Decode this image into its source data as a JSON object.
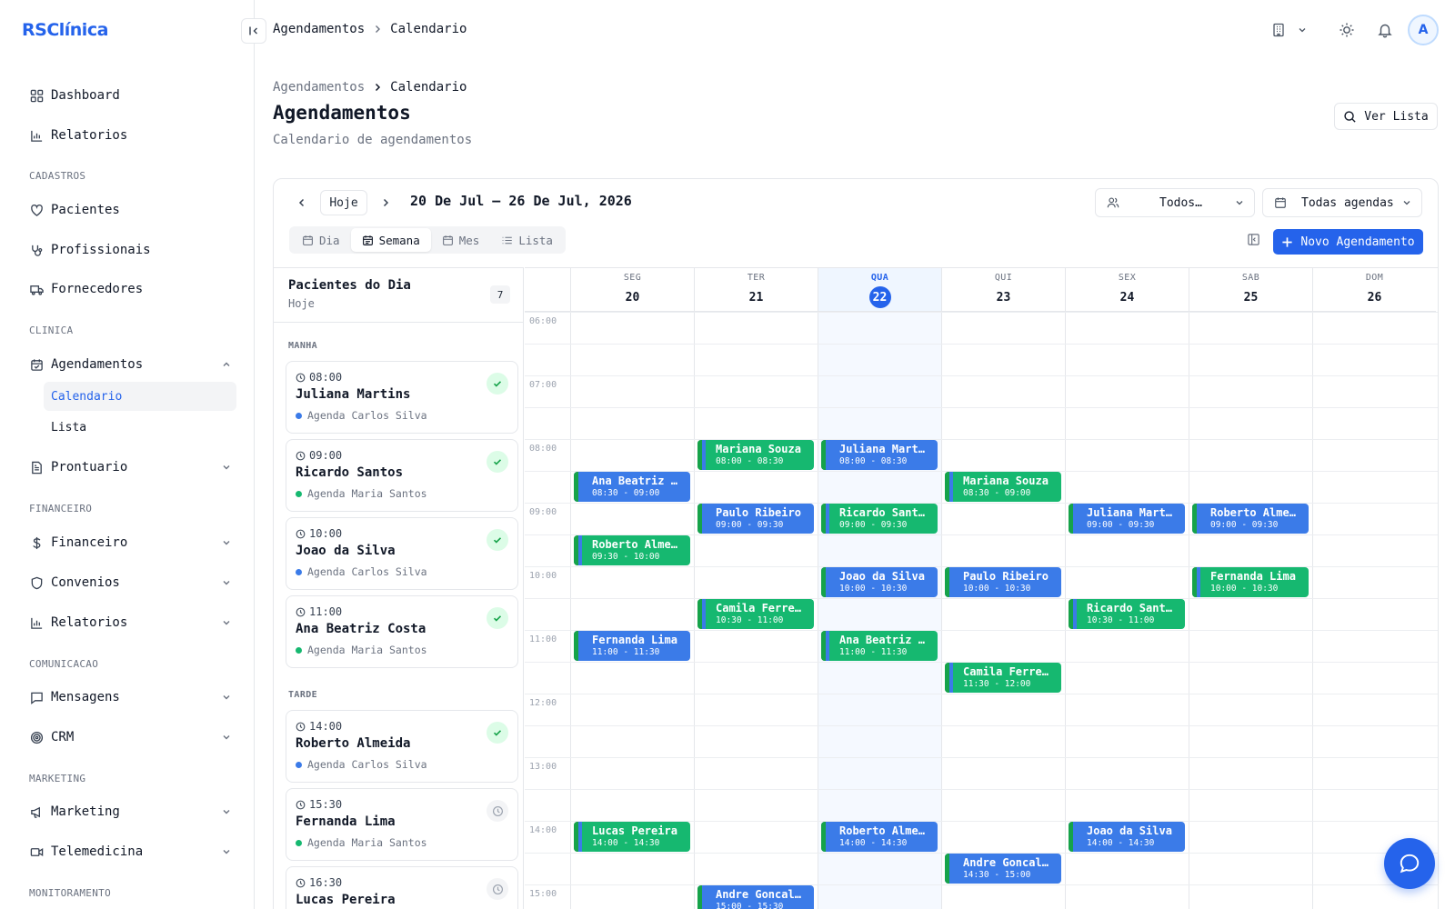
{
  "app": {
    "logo": "RSClínica"
  },
  "sidebar": {
    "items": [
      {
        "label": "Dashboard",
        "icon": "grid-icon"
      },
      {
        "label": "Relatorios",
        "icon": "bar-chart-icon"
      }
    ],
    "sections": {
      "cadastros": "CADASTROS",
      "clinica": "CLINICA",
      "financeiro": "FINANCEIRO",
      "comunicacao": "COMUNICACAO",
      "marketing": "MARKETING",
      "monitoramento": "MONITORAMENTO"
    },
    "cadastros": [
      "Pacientes",
      "Profissionais",
      "Fornecedores"
    ],
    "agendamentos": "Agendamentos",
    "agendamentos_sub": [
      "Calendario",
      "Lista"
    ],
    "prontuario": "Prontuario",
    "financeiro": [
      "Financeiro",
      "Convenios",
      "Relatorios"
    ],
    "comunicacao": [
      "Mensagens",
      "CRM"
    ],
    "marketing": [
      "Marketing",
      "Telemedicina"
    ]
  },
  "topbar": {
    "breadcrumb": [
      "Agendamentos",
      "Calendario"
    ]
  },
  "page": {
    "breadcrumb": [
      "Agendamentos",
      "Calendario"
    ],
    "title": "Agendamentos",
    "subtitle": "Calendario de agendamentos",
    "ver_lista": "Ver Lista"
  },
  "calendar": {
    "hoje": "Hoje",
    "range": "20 De Jul – 26 De Jul, 2026",
    "filter_prof": "Todos…",
    "filter_agenda": "Todas agendas",
    "views": [
      "Dia",
      "Semana",
      "Mes",
      "Lista"
    ],
    "active_view": "Semana",
    "novo": "Novo Agendamento",
    "days": [
      {
        "name": "SEG",
        "num": "20"
      },
      {
        "name": "TER",
        "num": "21"
      },
      {
        "name": "QUA",
        "num": "22",
        "today": true
      },
      {
        "name": "QUI",
        "num": "23"
      },
      {
        "name": "SEX",
        "num": "24"
      },
      {
        "name": "SAB",
        "num": "25"
      },
      {
        "name": "DOM",
        "num": "26"
      }
    ],
    "hours": [
      "06:00",
      "07:00",
      "08:00",
      "09:00",
      "10:00",
      "11:00",
      "12:00",
      "13:00",
      "14:00",
      "15:00"
    ],
    "events": [
      {
        "day": 1,
        "start": "08:00",
        "name": "Mariana Souza",
        "time": "08:00 - 08:30",
        "color": "green"
      },
      {
        "day": 2,
        "start": "08:00",
        "name": "Juliana Mart…",
        "time": "08:00 - 08:30",
        "color": "blue"
      },
      {
        "day": 0,
        "start": "08:30",
        "name": "Ana Beatriz …",
        "time": "08:30 - 09:00",
        "color": "blue"
      },
      {
        "day": 3,
        "start": "08:30",
        "name": "Mariana Souza",
        "time": "08:30 - 09:00",
        "color": "green"
      },
      {
        "day": 1,
        "start": "09:00",
        "name": "Paulo Ribeiro",
        "time": "09:00 - 09:30",
        "color": "blue"
      },
      {
        "day": 2,
        "start": "09:00",
        "name": "Ricardo Sant…",
        "time": "09:00 - 09:30",
        "color": "green"
      },
      {
        "day": 4,
        "start": "09:00",
        "name": "Juliana Mart…",
        "time": "09:00 - 09:30",
        "color": "blue"
      },
      {
        "day": 5,
        "start": "09:00",
        "name": "Roberto Alme…",
        "time": "09:00 - 09:30",
        "color": "blue"
      },
      {
        "day": 0,
        "start": "09:30",
        "name": "Roberto Alme…",
        "time": "09:30 - 10:00",
        "color": "green"
      },
      {
        "day": 2,
        "start": "10:00",
        "name": "Joao da Silva",
        "time": "10:00 - 10:30",
        "color": "blue"
      },
      {
        "day": 3,
        "start": "10:00",
        "name": "Paulo Ribeiro",
        "time": "10:00 - 10:30",
        "color": "blue"
      },
      {
        "day": 5,
        "start": "10:00",
        "name": "Fernanda Lima",
        "time": "10:00 - 10:30",
        "color": "green"
      },
      {
        "day": 1,
        "start": "10:30",
        "name": "Camila Ferre…",
        "time": "10:30 - 11:00",
        "color": "green"
      },
      {
        "day": 4,
        "start": "10:30",
        "name": "Ricardo Sant…",
        "time": "10:30 - 11:00",
        "color": "green"
      },
      {
        "day": 0,
        "start": "11:00",
        "name": "Fernanda Lima",
        "time": "11:00 - 11:30",
        "color": "blue"
      },
      {
        "day": 2,
        "start": "11:00",
        "name": "Ana Beatriz …",
        "time": "11:00 - 11:30",
        "color": "green"
      },
      {
        "day": 3,
        "start": "11:30",
        "name": "Camila Ferre…",
        "time": "11:30 - 12:00",
        "color": "green"
      },
      {
        "day": 0,
        "start": "14:00",
        "name": "Lucas Pereira",
        "time": "14:00 - 14:30",
        "color": "green"
      },
      {
        "day": 2,
        "start": "14:00",
        "name": "Roberto Alme…",
        "time": "14:00 - 14:30",
        "color": "blue"
      },
      {
        "day": 4,
        "start": "14:00",
        "name": "Joao da Silva",
        "time": "14:00 - 14:30",
        "color": "blue"
      },
      {
        "day": 3,
        "start": "14:30",
        "name": "Andre Goncal…",
        "time": "14:30 - 15:00",
        "color": "blue"
      },
      {
        "day": 1,
        "start": "15:00",
        "name": "Andre Goncal…",
        "time": "15:00 - 15:30",
        "color": "blue"
      }
    ]
  },
  "patients_panel": {
    "title": "Pacientes do Dia",
    "subtitle": "Hoje",
    "count": "7",
    "groups": {
      "manha": "MANHA",
      "tarde": "TARDE"
    },
    "manha": [
      {
        "time": "08:00",
        "name": "Juliana Martins",
        "agenda": "Agenda Carlos Silva",
        "dot": "#3b7be8",
        "status": "done"
      },
      {
        "time": "09:00",
        "name": "Ricardo Santos",
        "agenda": "Agenda Maria Santos",
        "dot": "#16b870",
        "status": "done"
      },
      {
        "time": "10:00",
        "name": "Joao da Silva",
        "agenda": "Agenda Carlos Silva",
        "dot": "#3b7be8",
        "status": "done"
      },
      {
        "time": "11:00",
        "name": "Ana Beatriz Costa",
        "agenda": "Agenda Maria Santos",
        "dot": "#16b870",
        "status": "done"
      }
    ],
    "tarde": [
      {
        "time": "14:00",
        "name": "Roberto Almeida",
        "agenda": "Agenda Carlos Silva",
        "dot": "#3b7be8",
        "status": "done"
      },
      {
        "time": "15:30",
        "name": "Fernanda Lima",
        "agenda": "Agenda Maria Santos",
        "dot": "#16b870",
        "status": "wait"
      },
      {
        "time": "16:30",
        "name": "Lucas Pereira",
        "agenda": "",
        "dot": "#16b870",
        "status": "wait"
      }
    ]
  },
  "colors": {
    "accent": "#2563eb",
    "green": "#16b870",
    "blue": "#3b7be8"
  }
}
